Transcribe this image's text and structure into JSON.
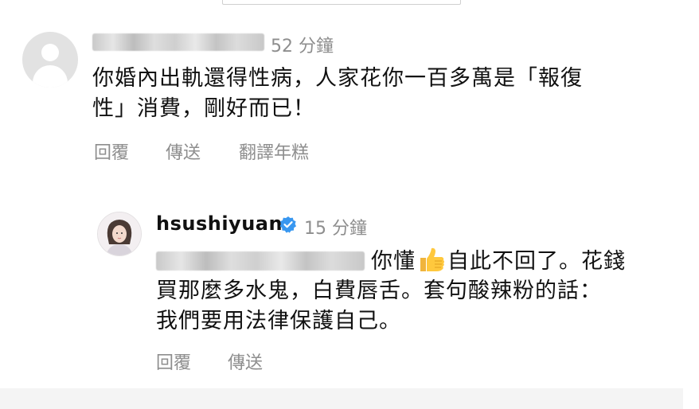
{
  "comment1": {
    "time": "52 分鐘",
    "line1": "你婚內出軌還得性病，人家花你一百多萬是「報復",
    "line2": "性」消費，剛好而已！",
    "actions": {
      "reply": "回覆",
      "send": "傳送",
      "translate": "翻譯年糕"
    }
  },
  "comment2": {
    "username": "hsushiyuan",
    "time": "15 分鐘",
    "line1_a": "你懂",
    "emoji": "thumbs-up-icon",
    "line1_b": "自此不回了。花錢",
    "line2": "買那麼多水鬼，白費唇舌。套句酸辣粉的話：",
    "line3": "我們要用法律保護自己。",
    "actions": {
      "reply": "回覆",
      "send": "傳送"
    }
  },
  "colors": {
    "secondary_text": "#8e8e8e",
    "verified_blue": "#3897f0",
    "primary_text": "#111111"
  }
}
